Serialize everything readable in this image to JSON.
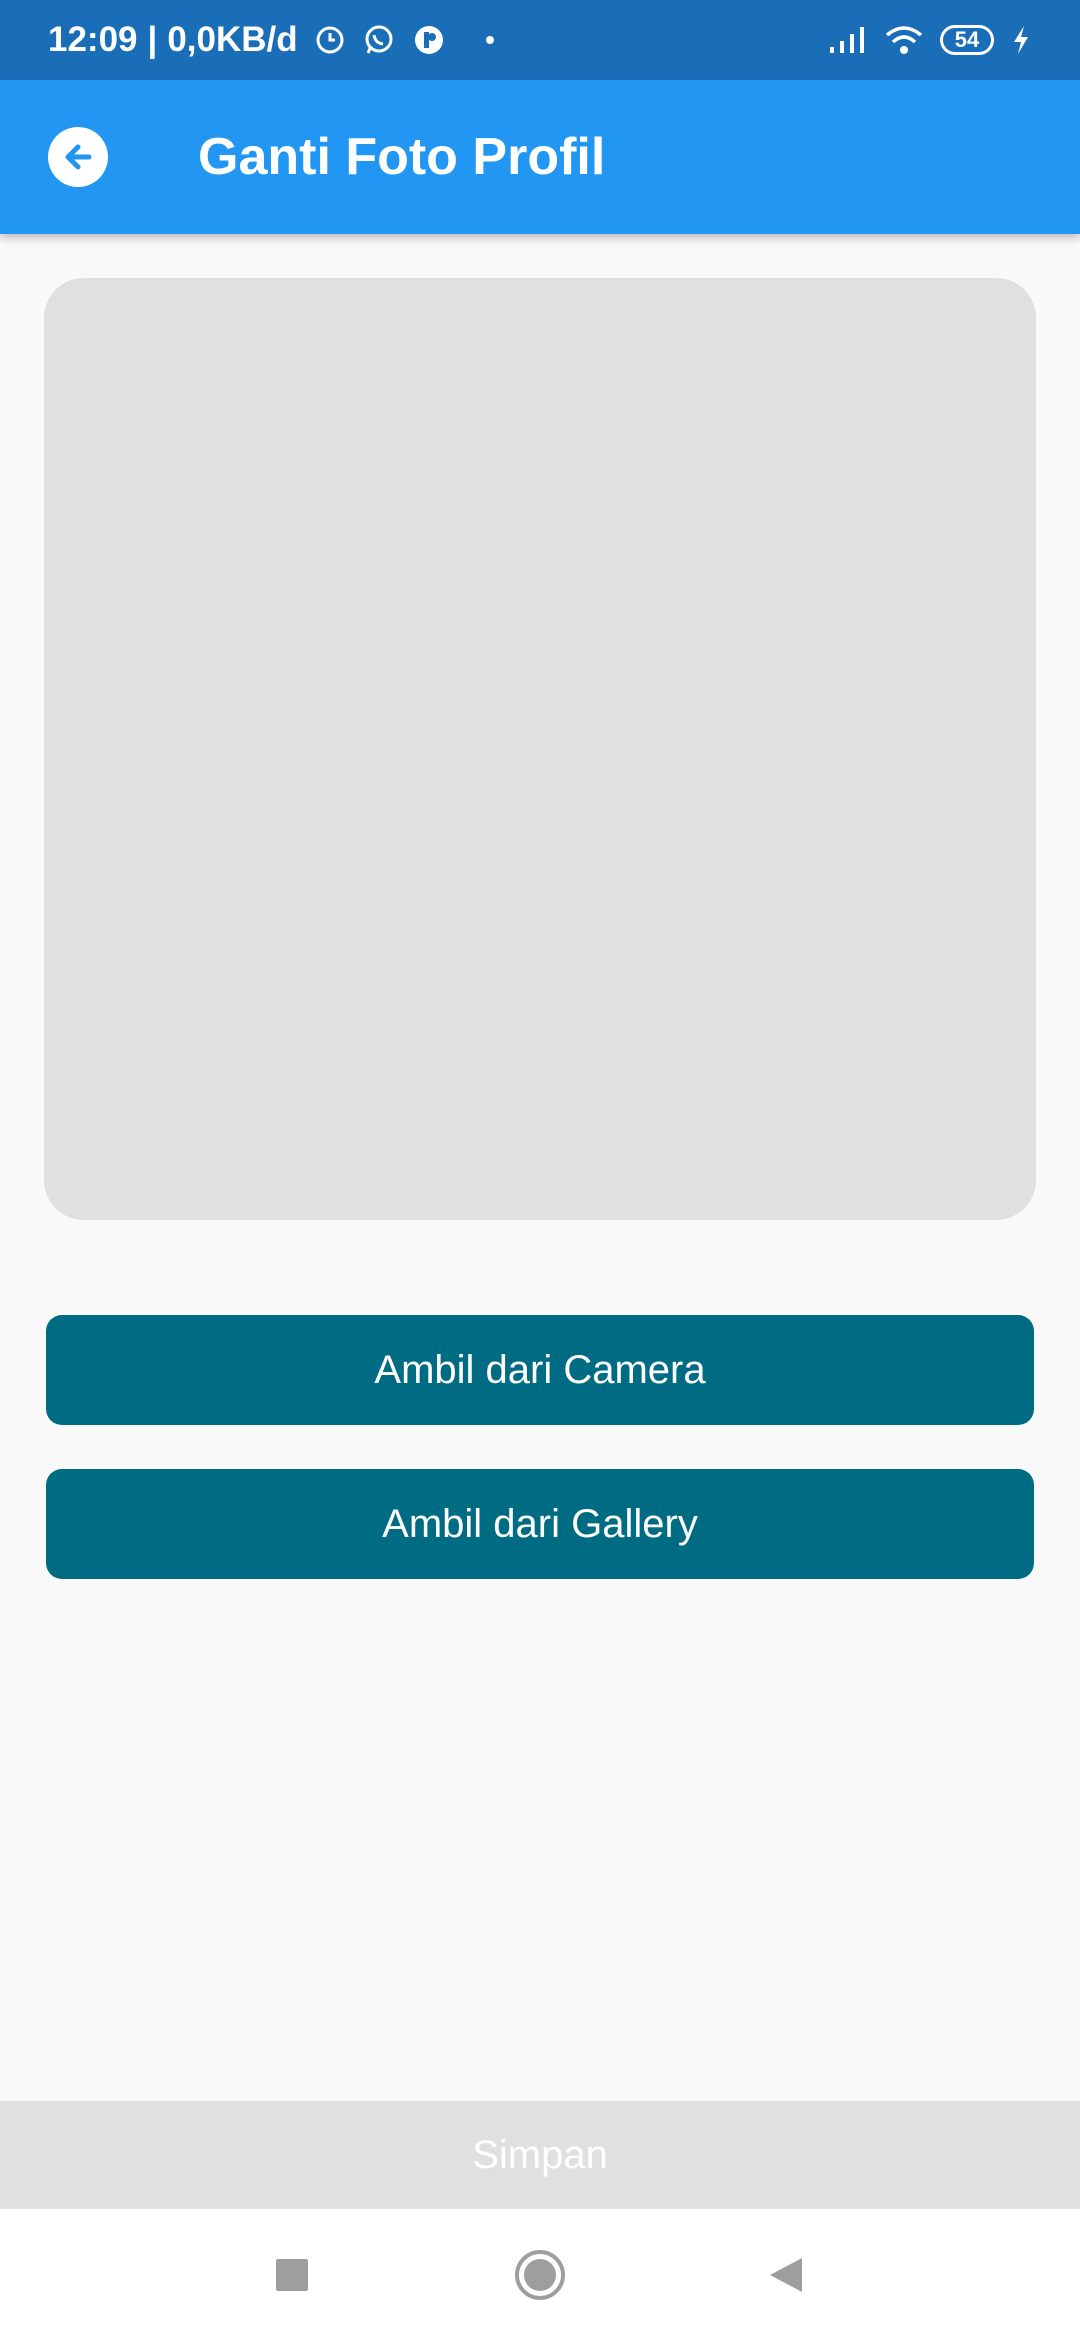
{
  "status_bar": {
    "time": "12:09",
    "separator": "|",
    "data_rate": "0,0KB/d",
    "battery": "54"
  },
  "app_bar": {
    "title": "Ganti Foto Profil",
    "back_icon": "arrow-back-icon"
  },
  "actions": {
    "camera_label": "Ambil dari Camera",
    "gallery_label": "Ambil dari Gallery"
  },
  "footer": {
    "save_label": "Simpan",
    "save_enabled": false
  },
  "nav": {
    "recents_icon": "square-icon",
    "home_icon": "circle-icon",
    "back_icon": "triangle-back-icon"
  },
  "colors": {
    "status_bar": "#1a6eb8",
    "app_bar": "#2196f3",
    "action_button": "#006c84",
    "placeholder": "#e0e0e0",
    "background": "#f9f9fa"
  }
}
